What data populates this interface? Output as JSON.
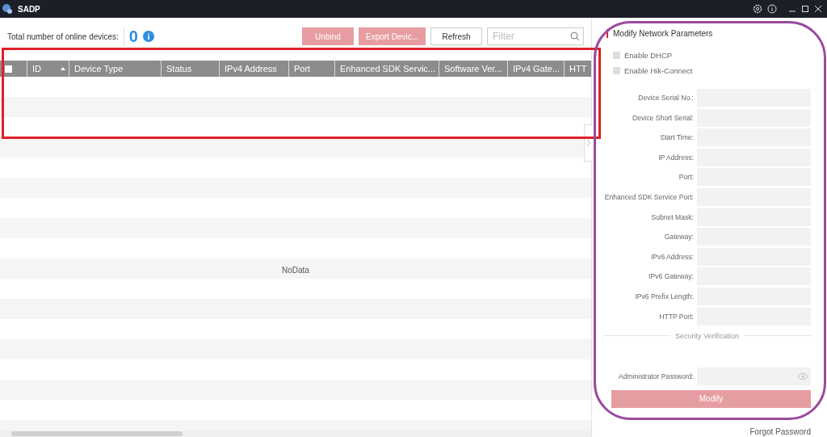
{
  "window": {
    "title": "SADP"
  },
  "toolbar": {
    "online_label": "Total number of online devices:",
    "online_count": "0",
    "buttons": [
      {
        "label": "Unbind",
        "disabled": true
      },
      {
        "label": "Export Devic...",
        "disabled": true
      },
      {
        "label": "Refresh",
        "disabled": false
      }
    ],
    "filter": {
      "placeholder": "Filter"
    }
  },
  "table": {
    "select_all": {
      "checked": false
    },
    "columns": [
      {
        "label": "ID",
        "sorted": true
      },
      {
        "label": "Device Type",
        "sorted": false
      },
      {
        "label": "Status",
        "sorted": false
      },
      {
        "label": "IPv4 Address",
        "sorted": false
      },
      {
        "label": "Port",
        "sorted": false
      },
      {
        "label": "Enhanced SDK Servic...",
        "sorted": false
      },
      {
        "label": "Software Ver...",
        "sorted": false
      },
      {
        "label": "IPv4 Gate...",
        "sorted": false
      },
      {
        "label": "HTT",
        "sorted": false
      }
    ],
    "empty_text": "NoData"
  },
  "panel": {
    "title": "Modify Network Parameters",
    "options": [
      {
        "label": "Enable DHCP",
        "checked": false
      },
      {
        "label": "Enable Hik-Connect",
        "checked": false
      }
    ],
    "fields": [
      {
        "label": "Device Serial No.:"
      },
      {
        "label": "Device Short Serial:"
      },
      {
        "label": "Start Time:"
      },
      {
        "label": "IP Address:"
      },
      {
        "label": "Port:"
      },
      {
        "label": "Enhanced SDK Service Port:"
      },
      {
        "label": "Subnet Mask:"
      },
      {
        "label": "Gateway:"
      },
      {
        "label": "IPv6 Address:"
      },
      {
        "label": "IPv6 Gateway:"
      },
      {
        "label": "IPv6 Prefix Length:"
      },
      {
        "label": "HTTP Port:"
      }
    ],
    "security_heading": "Security Verification",
    "password": {
      "label": "Administrator Password:"
    },
    "submit": {
      "label": "Modify",
      "disabled": true
    },
    "forgot_link": "Forgot Password"
  },
  "annotations": [
    {
      "kind": "rectangle",
      "color": "#e0202a"
    },
    {
      "kind": "rounded",
      "color": "#9b4a9e"
    }
  ]
}
